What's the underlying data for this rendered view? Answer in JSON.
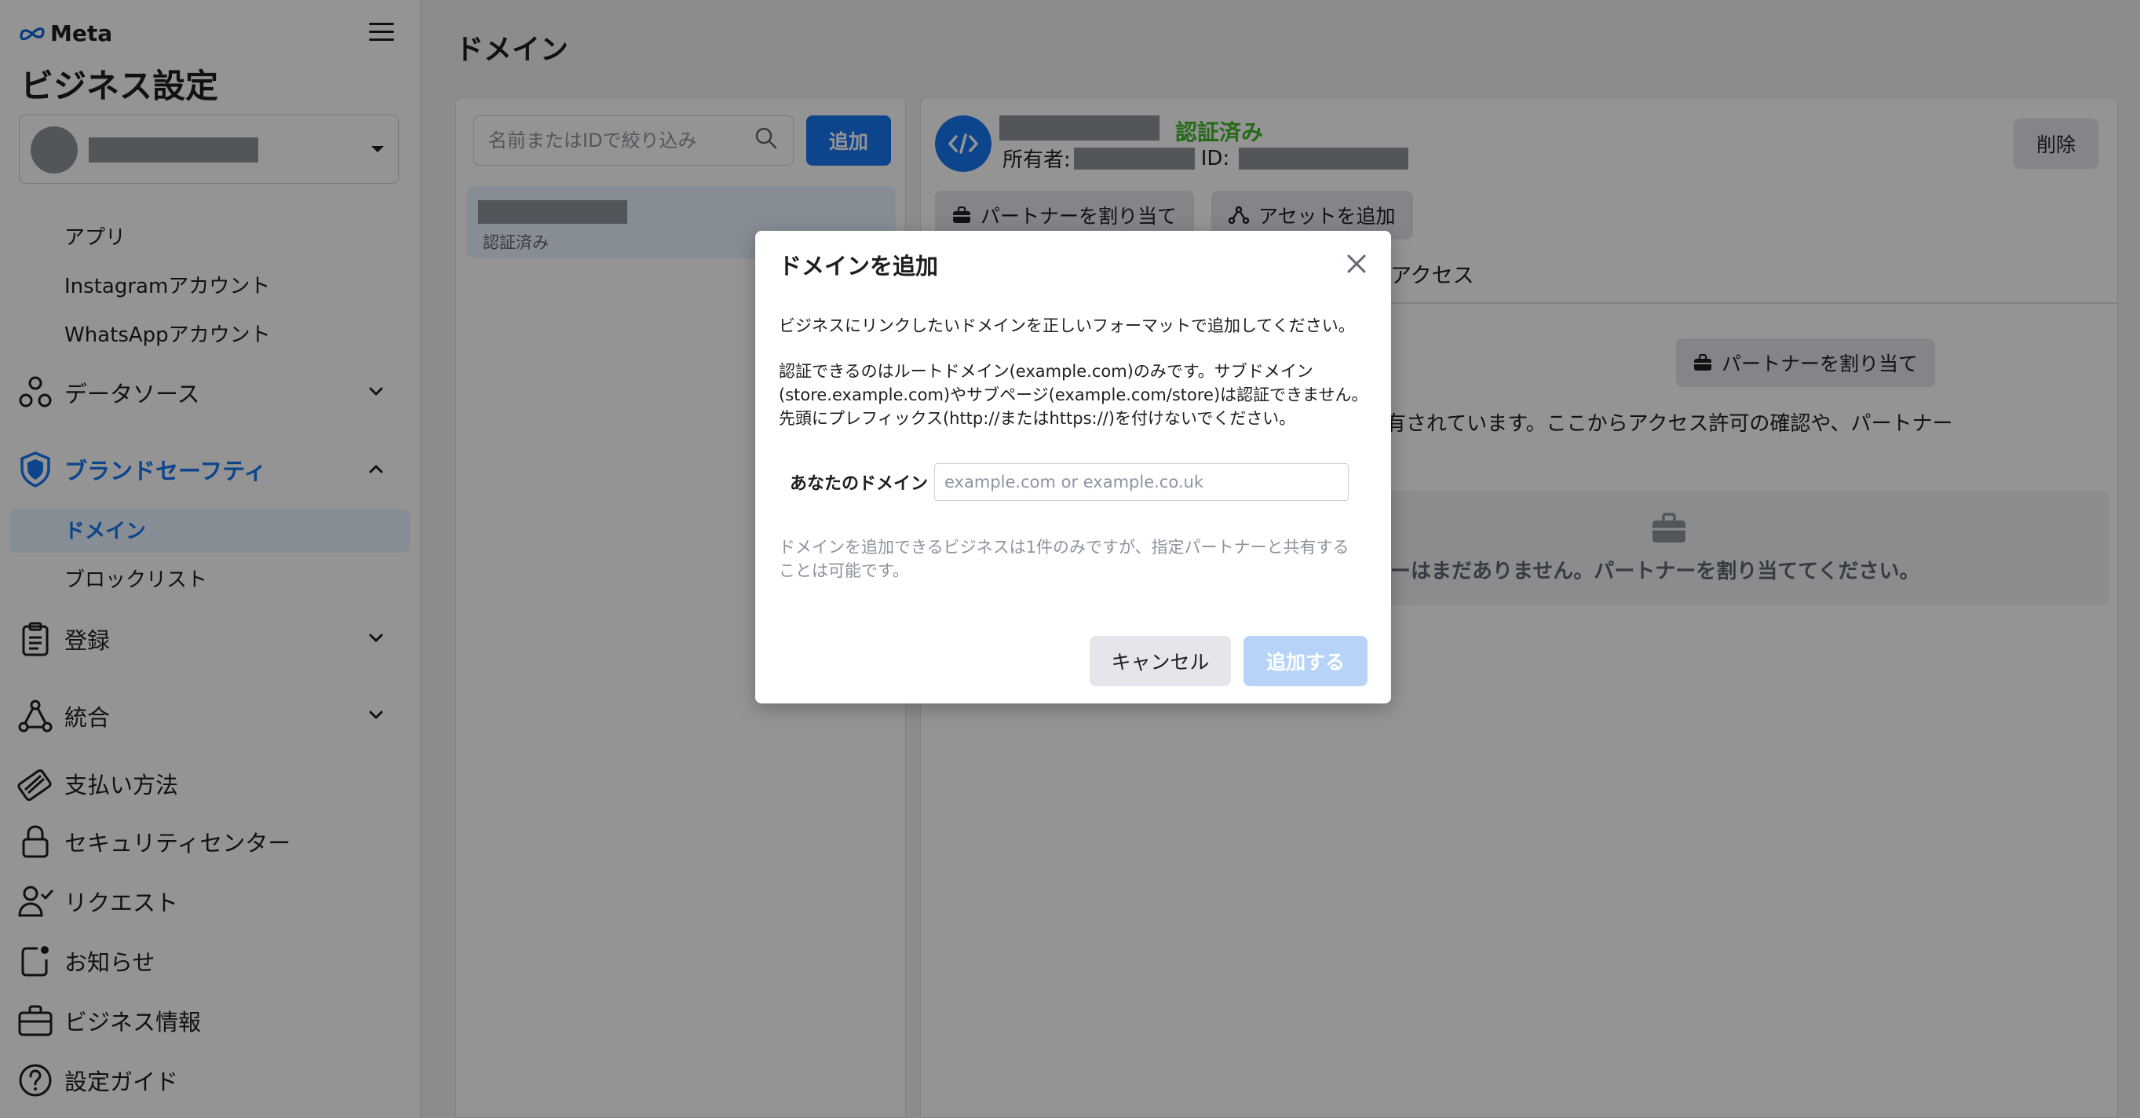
{
  "sidebar": {
    "brand": "Meta",
    "title": "ビジネス設定",
    "sub_items_top": [
      "アプリ",
      "Instagramアカウント",
      "WhatsAppアカウント"
    ],
    "data_sources": "データソース",
    "brand_safety": "ブランドセーフティ",
    "brand_safety_items": {
      "domains": "ドメイン",
      "blocklist": "ブロックリスト"
    },
    "registration": "登録",
    "integrations": "統合",
    "payment": "支払い方法",
    "security": "セキュリティセンター",
    "requests": "リクエスト",
    "notifications": "お知らせ",
    "business_info": "ビジネス情報",
    "setup_guide": "設定ガイド",
    "icons": {
      "data_sources": "data-source-icon",
      "brand_safety": "shield-icon",
      "registration": "clipboard-icon",
      "integrations": "integration-icon",
      "payment": "card-icon",
      "security": "lock-icon",
      "requests": "person-check-icon",
      "notifications": "notification-icon",
      "business_info": "briefcase-icon",
      "setup_guide": "help-icon"
    }
  },
  "main": {
    "page_title": "ドメイン",
    "search": {
      "placeholder": "名前またはIDで絞り込み",
      "value": ""
    },
    "add_label": "追加",
    "list": [
      {
        "status": "認証済み"
      }
    ]
  },
  "detail": {
    "status": "認証済み",
    "owner_label": "所有者:",
    "id_label": "ID:",
    "delete_label": "削除",
    "assign_partner_label": "パートナーを割り当て",
    "add_asset_label": "アセットを追加",
    "tab_access_fragment": "アクセス",
    "description_fragment": "有されています。ここからアクセス許可の確認や、パートナー",
    "empty_message_fragment": "ーはまだありません。パートナーを割り当ててください。"
  },
  "modal": {
    "title": "ドメインを追加",
    "intro": "ビジネスにリンクしたいドメインを正しいフォーマットで追加してください。",
    "note_lines": [
      "認証できるのはルートドメイン(example.com)のみです。サブドメイン",
      "(store.example.com)やサブページ(example.com/store)は認証できません。",
      "先頭にプレフィックス(http://またはhttps://)を付けないでください。"
    ],
    "field_label": "あなたのドメイン",
    "field_placeholder": "example.com or example.co.uk",
    "field_value": "",
    "hint_lines": [
      "ドメインを追加できるビジネスは1件のみですが、指定パートナーと共有する",
      "ことは可能です。"
    ],
    "cancel_label": "キャンセル",
    "submit_label": "追加する"
  },
  "colors": {
    "accent": "#1877f2",
    "verified": "#42b72a",
    "disabled_button": "#b7d4f8",
    "redaction": "#8d949e"
  }
}
